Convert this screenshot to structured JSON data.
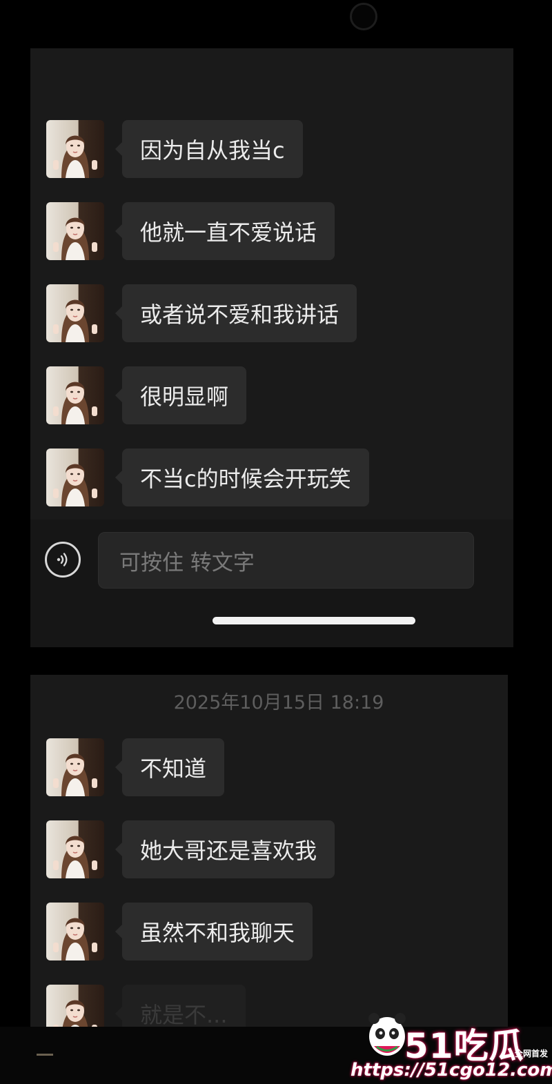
{
  "chat_top": {
    "messages": [
      {
        "text": "因为自从我当c"
      },
      {
        "text": "他就一直不爱说话"
      },
      {
        "text": "或者说不爱和我讲话"
      },
      {
        "text": "很明显啊"
      },
      {
        "text": "不当c的时候会开玩笑"
      }
    ],
    "input": {
      "placeholder": "可按住 转文字",
      "voice_icon": "voice-wave-icon"
    }
  },
  "chat_bottom": {
    "timestamp": "2025年10月15日 18:19",
    "messages": [
      {
        "text": "不知道"
      },
      {
        "text": "她大哥还是喜欢我"
      },
      {
        "text": "虽然不和我聊天"
      },
      {
        "text": "就是不..."
      }
    ]
  },
  "watermark": {
    "logo": "51吃瓜",
    "badge": "全网首发",
    "url": "https://51cgo12.com"
  },
  "colors": {
    "bubble": "#2c2c2c",
    "background": "#1a1a1a",
    "accent": "#e0195a"
  }
}
